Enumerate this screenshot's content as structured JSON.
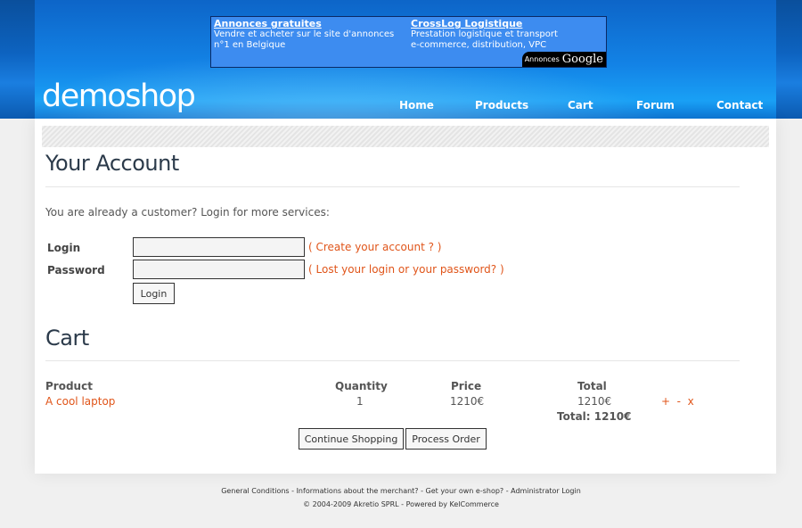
{
  "ads": [
    {
      "title": "Annonces gratuites",
      "line1": "Vendre et acheter sur le site d'annonces",
      "line2": "n°1 en Belgique"
    },
    {
      "title": "CrossLog Logistique",
      "line1": "Prestation logistique et transport",
      "line2": "e-commerce, distribution, VPC"
    }
  ],
  "google_badge": {
    "label": "Annonces",
    "brand": "Google"
  },
  "logo": "demoshop",
  "nav": [
    "Home",
    "Products",
    "Cart",
    "Forum",
    "Contact"
  ],
  "account": {
    "title": "Your Account",
    "intro": "You are already a customer? Login for more services:",
    "login_label": "Login",
    "password_label": "Password",
    "login_value": "",
    "password_value": "",
    "create_link_pre": "( ",
    "create_link": "Create your account ?",
    "create_link_post": " )",
    "lost_link_pre": "( ",
    "lost_link": "Lost your login or your password?",
    "lost_link_post": " )",
    "login_button": "Login"
  },
  "cart": {
    "title": "Cart",
    "headers": {
      "product": "Product",
      "quantity": "Quantity",
      "price": "Price",
      "total": "Total"
    },
    "items": [
      {
        "product": "A cool laptop",
        "quantity": "1",
        "price": "1210€",
        "total": "1210€",
        "actions": "+  -  x"
      }
    ],
    "grand_total": "Total: 1210€",
    "continue_button": "Continue Shopping",
    "process_button": "Process Order"
  },
  "footer": {
    "links": "General Conditions - Informations about the merchant? -  Get your own e-shop? -  Administrator Login",
    "copyright": "© 2004-2009 Akretio SPRL - Powered by KelCommerce"
  },
  "colors": {
    "accent": "#e0551a",
    "header_blue": "#1383e6",
    "heading": "#2b3a4a"
  }
}
